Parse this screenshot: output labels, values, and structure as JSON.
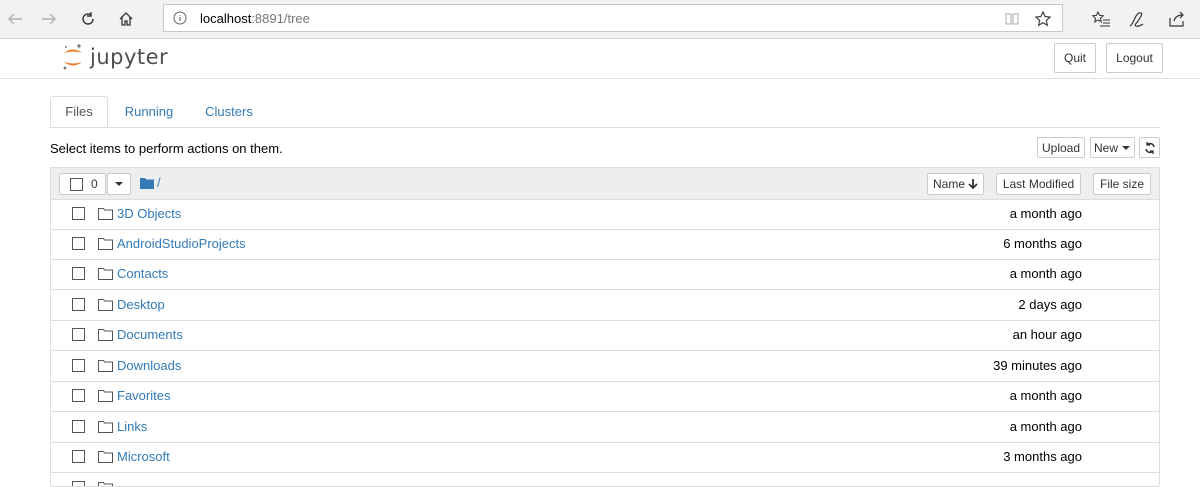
{
  "browser": {
    "url_host": "localhost",
    "url_rest": ":8891/tree"
  },
  "header": {
    "logo_text": "jupyter",
    "quit_label": "Quit",
    "logout_label": "Logout"
  },
  "tabs": [
    {
      "label": "Files",
      "active": true
    },
    {
      "label": "Running",
      "active": false
    },
    {
      "label": "Clusters",
      "active": false
    }
  ],
  "toolbar": {
    "select_message": "Select items to perform actions on them.",
    "upload_label": "Upload",
    "new_label": "New",
    "refresh_icon": "refresh-icon"
  },
  "list_header": {
    "selected_count": "0",
    "path": "/",
    "sort_name_label": "Name",
    "last_modified_label": "Last Modified",
    "file_size_label": "File size"
  },
  "files": [
    {
      "name": "3D Objects",
      "modified": "a month ago"
    },
    {
      "name": "AndroidStudioProjects",
      "modified": "6 months ago"
    },
    {
      "name": "Contacts",
      "modified": "a month ago"
    },
    {
      "name": "Desktop",
      "modified": "2 days ago"
    },
    {
      "name": "Documents",
      "modified": "an hour ago"
    },
    {
      "name": "Downloads",
      "modified": "39 minutes ago"
    },
    {
      "name": "Favorites",
      "modified": "a month ago"
    },
    {
      "name": "Links",
      "modified": "a month ago"
    },
    {
      "name": "Microsoft",
      "modified": "3 months ago"
    }
  ],
  "colors": {
    "link": "#337ab7",
    "logo_orange": "#f37626"
  }
}
